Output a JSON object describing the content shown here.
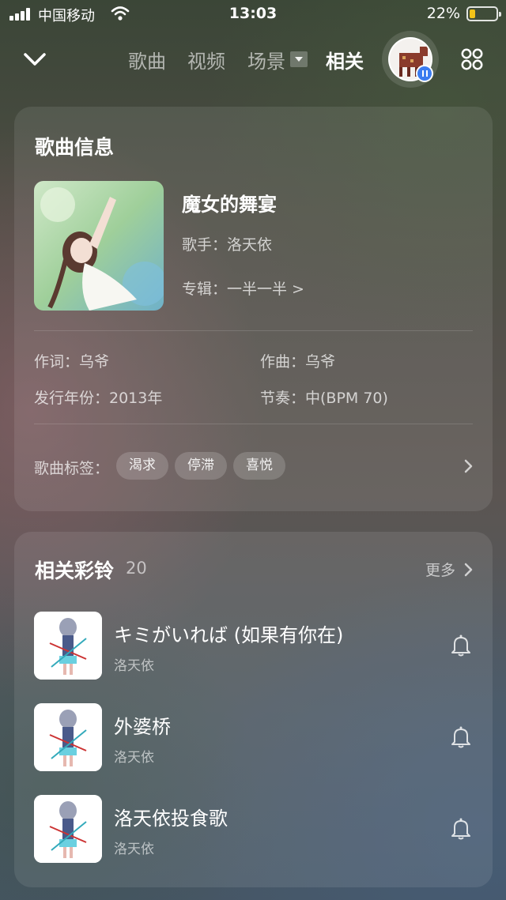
{
  "status_bar": {
    "carrier": "中国移动",
    "time": "13:03",
    "battery": "22%",
    "battery_level": 0.22,
    "icons": [
      "signal-icon",
      "wifi-icon",
      "battery-icon"
    ]
  },
  "nav": {
    "back_icon": "chevron-down-icon",
    "tabs": [
      {
        "label": "歌曲",
        "active": false
      },
      {
        "label": "视频",
        "active": false
      },
      {
        "label": "场景",
        "active": false
      },
      {
        "label": "相关",
        "active": true
      }
    ],
    "scene_dropdown_icon": "caret-down-icon",
    "menu_icon": "grid-circles-icon"
  },
  "song_info": {
    "title": "歌曲信息",
    "song_name": "魔女的舞宴",
    "singer": "歌手：洛天依",
    "album": "专辑：一半一半 >",
    "lyricist": "作词：乌爷",
    "composer": "作曲：乌爷",
    "year": "发行年份：2013年",
    "tempo": "节奏：中(BPM 70)",
    "tags_label": "歌曲标签：",
    "tags": [
      "渴求",
      "停滞",
      "喜悦"
    ]
  },
  "ringtones": {
    "title": "相关彩铃",
    "count": "20",
    "more": "更多",
    "items": [
      {
        "title": "キミがいれば (如果有你在)",
        "artist": "洛天依"
      },
      {
        "title": "外婆桥",
        "artist": "洛天依"
      },
      {
        "title": "洛天依投食歌",
        "artist": "洛天依"
      }
    ]
  },
  "colors": {
    "accent_blue": "#3b7cf0",
    "battery_yellow": "#f2c318"
  }
}
